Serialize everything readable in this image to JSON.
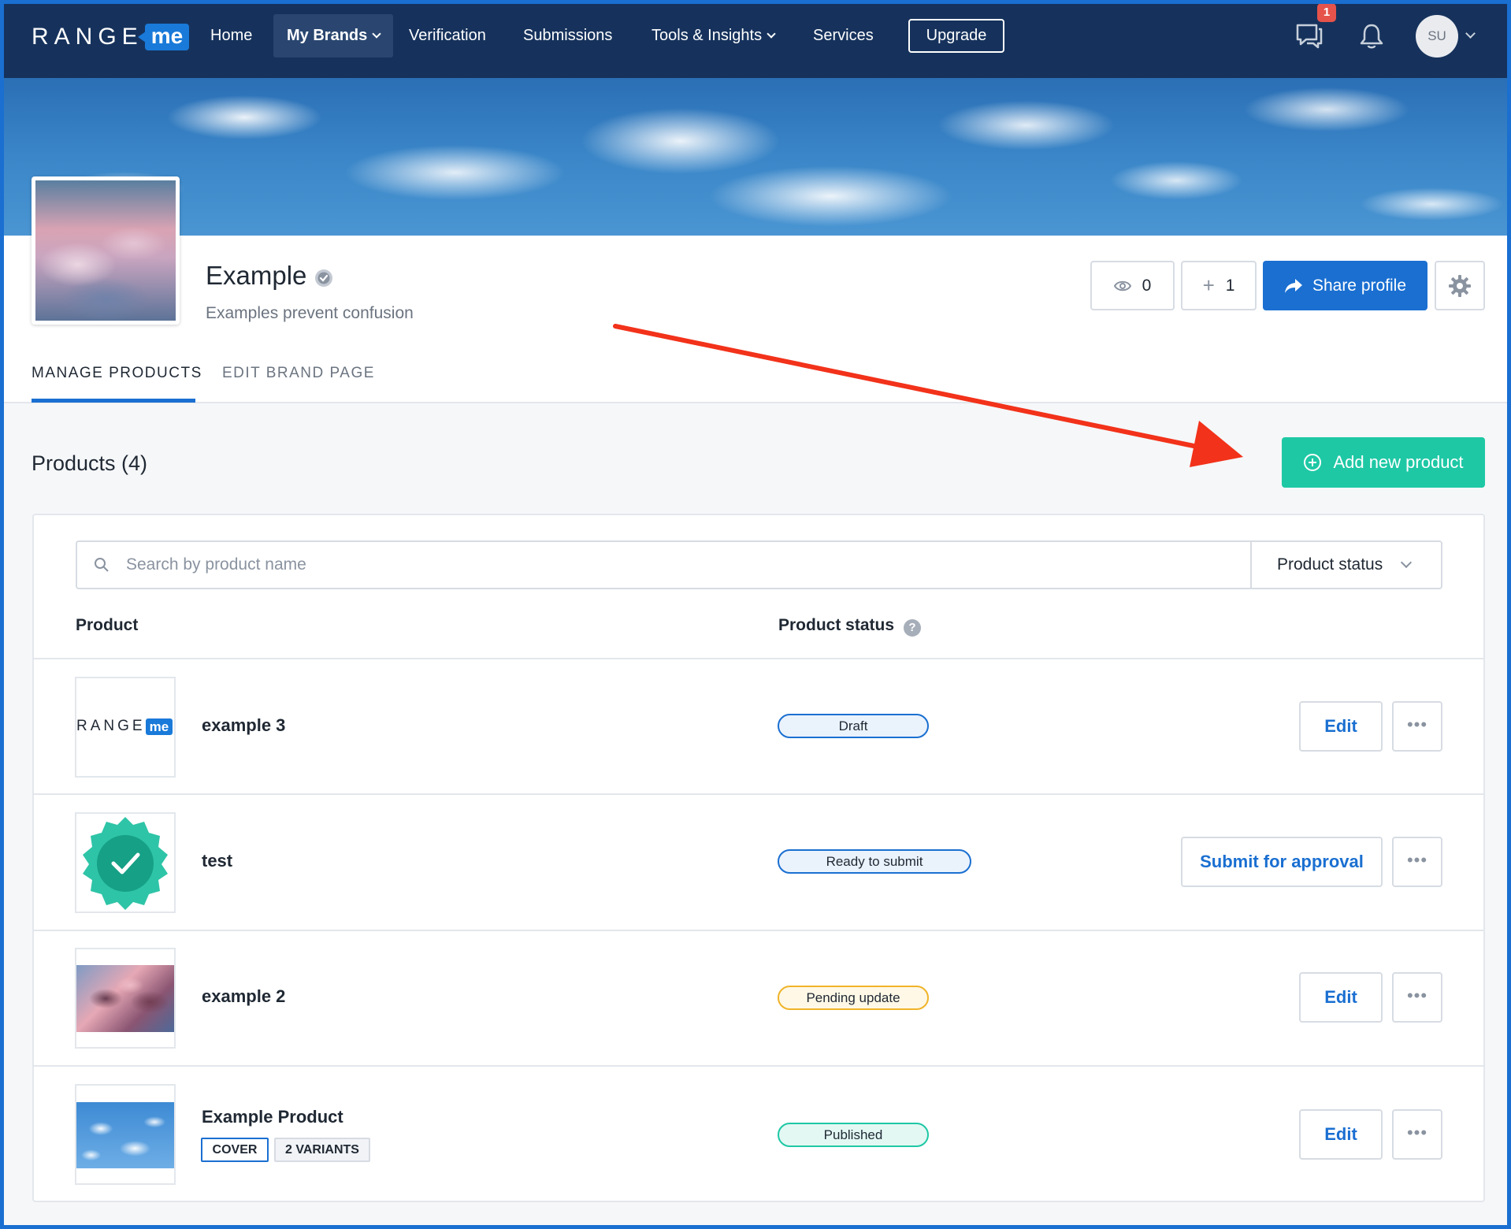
{
  "nav": {
    "logo_range": "RANGE",
    "logo_me": "me",
    "items": [
      "Home",
      "My Brands",
      "Verification",
      "Submissions",
      "Tools & Insights",
      "Services"
    ],
    "upgrade": "Upgrade",
    "chat_badge": "1",
    "avatar_initials": "SU"
  },
  "brand": {
    "name": "Example",
    "tagline": "Examples prevent confusion",
    "views": "0",
    "follows": "1",
    "share_label": "Share profile"
  },
  "tabs": [
    "MANAGE PRODUCTS",
    "EDIT BRAND PAGE"
  ],
  "products": {
    "title": "Products (4)",
    "add_label": "Add new product",
    "search_placeholder": "Search by product name",
    "status_filter": "Product status",
    "col_product": "Product",
    "col_status": "Product status",
    "help": "?",
    "rows": [
      {
        "name": "example 3",
        "status": "Draft",
        "action": "Edit",
        "more": "•••",
        "thumb_text_range": "RANGE",
        "thumb_text_me": "me"
      },
      {
        "name": "test",
        "status": "Ready to submit",
        "action": "Submit for approval",
        "more": "•••"
      },
      {
        "name": "example 2",
        "status": "Pending update",
        "action": "Edit",
        "more": "•••"
      },
      {
        "name": "Example Product",
        "status": "Published",
        "action": "Edit",
        "more": "•••",
        "tags": [
          "COVER",
          "2 VARIANTS"
        ]
      }
    ]
  },
  "colors": {
    "nav_bg": "#16325c",
    "primary": "#1a6fd1",
    "success": "#1ec8a5",
    "warning": "#f0b429",
    "annotation_arrow": "#f2321a"
  }
}
